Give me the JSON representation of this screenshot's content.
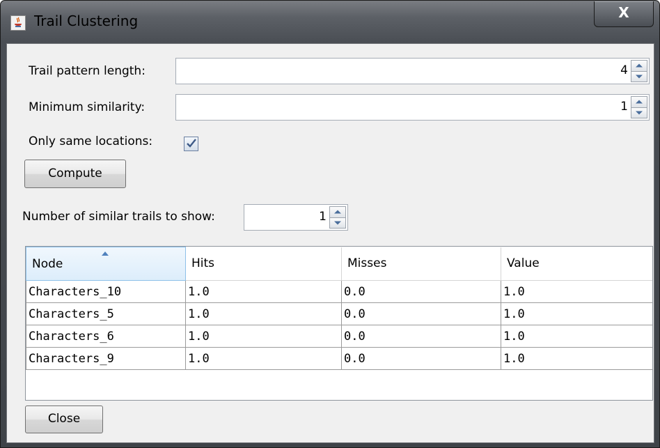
{
  "window": {
    "title": "Trail Clustering",
    "close_label": "X"
  },
  "form": {
    "trail_pattern_length": {
      "label": "Trail pattern length:",
      "value": "4"
    },
    "minimum_similarity": {
      "label": "Minimum similarity:",
      "value": "1"
    },
    "only_same_locations": {
      "label": "Only same locations:",
      "checked": true
    },
    "compute_label": "Compute",
    "similar_trails": {
      "label": "Number of similar trails to show:",
      "value": "1"
    }
  },
  "table": {
    "columns": [
      "Node",
      "Hits",
      "Misses",
      "Value"
    ],
    "sorted_column": "Node",
    "rows": [
      [
        "Characters_10",
        "1.0",
        "0.0",
        "1.0"
      ],
      [
        "Characters_5",
        "1.0",
        "0.0",
        "1.0"
      ],
      [
        "Characters_6",
        "1.0",
        "0.0",
        "1.0"
      ],
      [
        "Characters_9",
        "1.0",
        "0.0",
        "1.0"
      ]
    ]
  },
  "footer": {
    "close_label": "Close"
  },
  "icons": {
    "app": "java-coffee-cup-icon",
    "check": "checkmark-icon",
    "sort": "sort-ascending-icon"
  },
  "colors": {
    "titlebar": "#5c6066",
    "client": "#f0f0f0",
    "sorted_header": "#dcedfb",
    "check": "#3d5a87"
  }
}
